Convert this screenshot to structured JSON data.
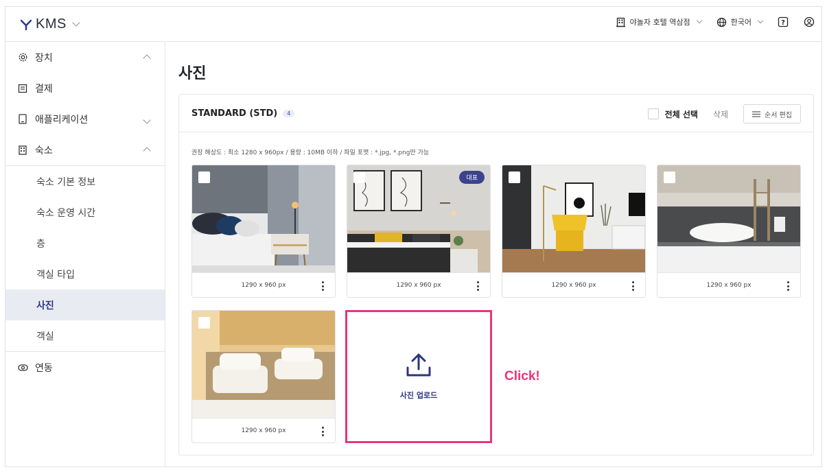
{
  "app": {
    "name": "KMS"
  },
  "topbar": {
    "property": "야놀자 호텔 역삼점",
    "language": "한국어"
  },
  "sidebar": {
    "items": [
      {
        "label": "장치",
        "icon": "gear-icon",
        "state": "expanded"
      },
      {
        "label": "결제",
        "icon": "receipt-icon"
      },
      {
        "label": "애플리케이션",
        "icon": "tablet-icon",
        "state": "collapsed"
      },
      {
        "label": "숙소",
        "icon": "building-icon",
        "state": "expanded"
      }
    ],
    "sub_items": [
      {
        "label": "숙소 기본 정보"
      },
      {
        "label": "숙소 운영 시간"
      },
      {
        "label": "층"
      },
      {
        "label": "객실 타입"
      },
      {
        "label": "사진",
        "active": true
      },
      {
        "label": "객실"
      }
    ],
    "after": [
      {
        "label": "연동",
        "icon": "link-toggle-icon"
      }
    ]
  },
  "main": {
    "title": "사진",
    "card": {
      "room_type": "STANDARD (STD)",
      "count": "4",
      "select_all": "전체 선택",
      "delete": "삭제",
      "reorder": "순서 편집",
      "hint": "권장 해상도 : 최소 1280 x 960px  / 용량 : 10MB 이하 / 파일 포맷 : *.jpg, *.png만 가능",
      "photos": [
        {
          "size": "1290 x 960 px",
          "representative": false
        },
        {
          "size": "1290 x 960 px",
          "representative": true,
          "badge": "대표"
        },
        {
          "size": "1290 x 960 px",
          "representative": false
        },
        {
          "size": "1290 x 960 px",
          "representative": false
        },
        {
          "size": "1290 x 960 px",
          "representative": false
        }
      ],
      "upload_label": "사진 업로드"
    },
    "annotation": "Click!"
  },
  "colors": {
    "accent": "#2c3680",
    "highlight": "#e8357a",
    "active_bg": "#e8ebf2"
  }
}
